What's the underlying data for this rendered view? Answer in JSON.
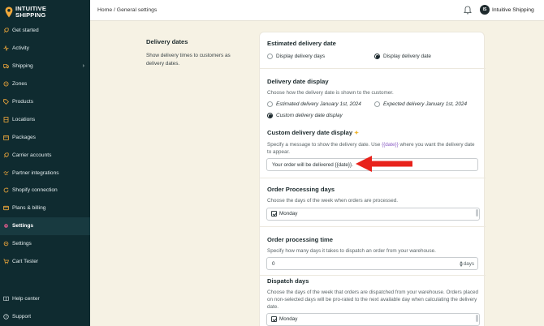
{
  "brand": {
    "line1": "INTUITIVE",
    "line2": "SHIPPING",
    "accent": "#f2a93b"
  },
  "sidebar": {
    "items": [
      {
        "label": "Get started",
        "icon": "rocket-icon"
      },
      {
        "label": "Activity",
        "icon": "activity-icon"
      },
      {
        "label": "Shipping",
        "icon": "truck-icon"
      },
      {
        "label": "Zones",
        "icon": "location-pin-icon"
      },
      {
        "label": "Products",
        "icon": "tag-icon"
      },
      {
        "label": "Locations",
        "icon": "building-icon"
      },
      {
        "label": "Packages",
        "icon": "package-icon"
      },
      {
        "label": "Carrier accounts",
        "icon": "rocket-icon"
      },
      {
        "label": "Partner integrations",
        "icon": "handshake-icon"
      },
      {
        "label": "Shopify connection",
        "icon": "refresh-icon"
      },
      {
        "label": "Plans & billing",
        "icon": "credit-card-icon"
      },
      {
        "label": "Settings",
        "icon": "gear-icon"
      },
      {
        "label": "Settings",
        "icon": "gear-icon"
      },
      {
        "label": "Cart Tester",
        "icon": "cart-icon"
      }
    ],
    "bottom": [
      {
        "label": "Help center",
        "icon": "book-icon"
      },
      {
        "label": "Support",
        "icon": "help-circle-icon"
      }
    ]
  },
  "topbar": {
    "breadcrumb": "Home / General settings",
    "avatar_initials": "IS",
    "account_name": "Intuitive Shipping"
  },
  "section": {
    "title": "Delivery dates",
    "description": "Show delivery times to customers as delivery dates."
  },
  "card": {
    "estimated": {
      "title": "Estimated delivery date",
      "options": [
        "Display delivery days",
        "Display delivery date"
      ],
      "selected": 1
    },
    "display": {
      "title": "Delivery date display",
      "description": "Choose how the delivery date is shown to the customer.",
      "options": [
        "Estimated delivery January 1st, 2024",
        "Expected delivery January 1st, 2024",
        "Custom delivery date display"
      ],
      "selected": 2
    },
    "custom": {
      "title": "Custom delivery date display",
      "desc_before": "Specify a message to show the delivery date. Use ",
      "desc_code": "{{date}}",
      "desc_after": " where you want the delivery date to appear.",
      "value": "Your order will be delivered {{date}}."
    },
    "processing_days": {
      "title": "Order Processing days",
      "description": "Choose the days of the week when orders are processed.",
      "first_day": "Monday"
    },
    "processing_time": {
      "title": "Order processing time",
      "description": "Specify how many days it takes to dispatch an order from your warehouse.",
      "value": "0",
      "suffix": "days"
    },
    "dispatch_days": {
      "title": "Dispatch days",
      "description": "Choose the days of the week that orders are dispatched from your warehouse. Orders placed on non-selected days will be pro-rated to the next available day when calculating the delivery date.",
      "first_day": "Monday"
    }
  }
}
